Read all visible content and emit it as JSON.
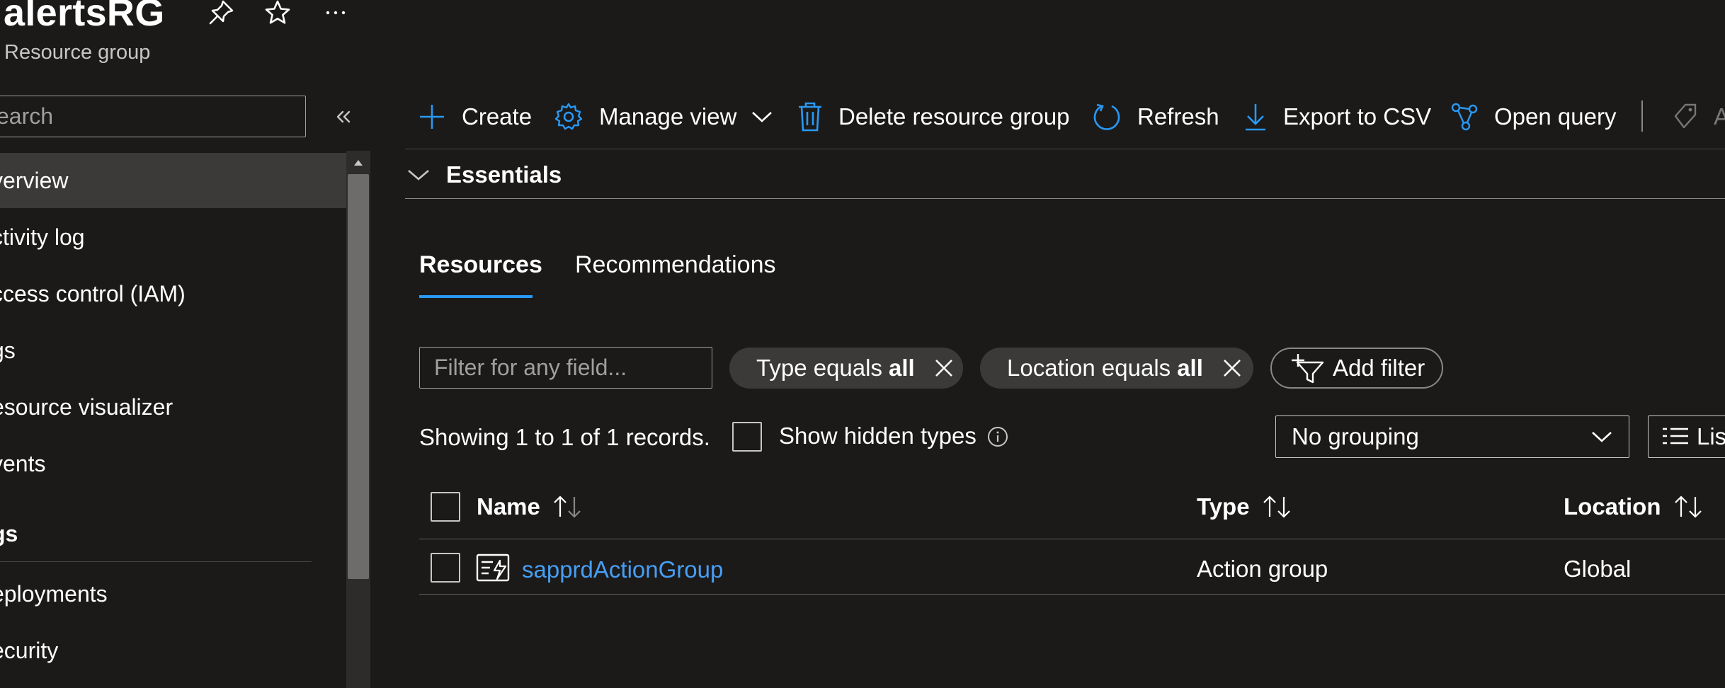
{
  "header": {
    "title": "alertsRG",
    "subtitle": "Resource group"
  },
  "sidebar": {
    "search_placeholder": "earch",
    "items": [
      {
        "label": "verview",
        "active": true
      },
      {
        "label": "ctivity log"
      },
      {
        "label": "ccess control (IAM)"
      },
      {
        "label": "gs"
      },
      {
        "label": "esource visualizer"
      },
      {
        "label": "vents"
      }
    ],
    "section_label": "gs",
    "section_items": [
      {
        "label": "eployments"
      },
      {
        "label": "ecurity"
      }
    ]
  },
  "toolbar": {
    "create": "Create",
    "manage_view": "Manage view",
    "delete": "Delete resource group",
    "refresh": "Refresh",
    "export": "Export to CSV",
    "open_query": "Open query",
    "assign_tags_partial": "A"
  },
  "essentials": {
    "label": "Essentials"
  },
  "tabs": [
    {
      "label": "Resources",
      "active": true
    },
    {
      "label": "Recommendations"
    }
  ],
  "filters": {
    "placeholder": "Filter for any field...",
    "type_prefix": "Type equals",
    "type_value": "all",
    "location_prefix": "Location equals",
    "location_value": "all",
    "add_filter": "Add filter"
  },
  "records_text": "Showing 1 to 1 of 1 records.",
  "show_hidden_label": "Show hidden types",
  "grouping": {
    "selected": "No grouping"
  },
  "view_toggle": "List view",
  "table": {
    "columns": [
      "Name",
      "Type",
      "Location"
    ],
    "rows": [
      {
        "name": "sapprdActionGroup",
        "type": "Action group",
        "location": "Global"
      }
    ]
  },
  "colors": {
    "background": "#1b1a19",
    "accent": "#2899f5",
    "link": "#479ef5",
    "active_nav": "#3b3a39"
  }
}
